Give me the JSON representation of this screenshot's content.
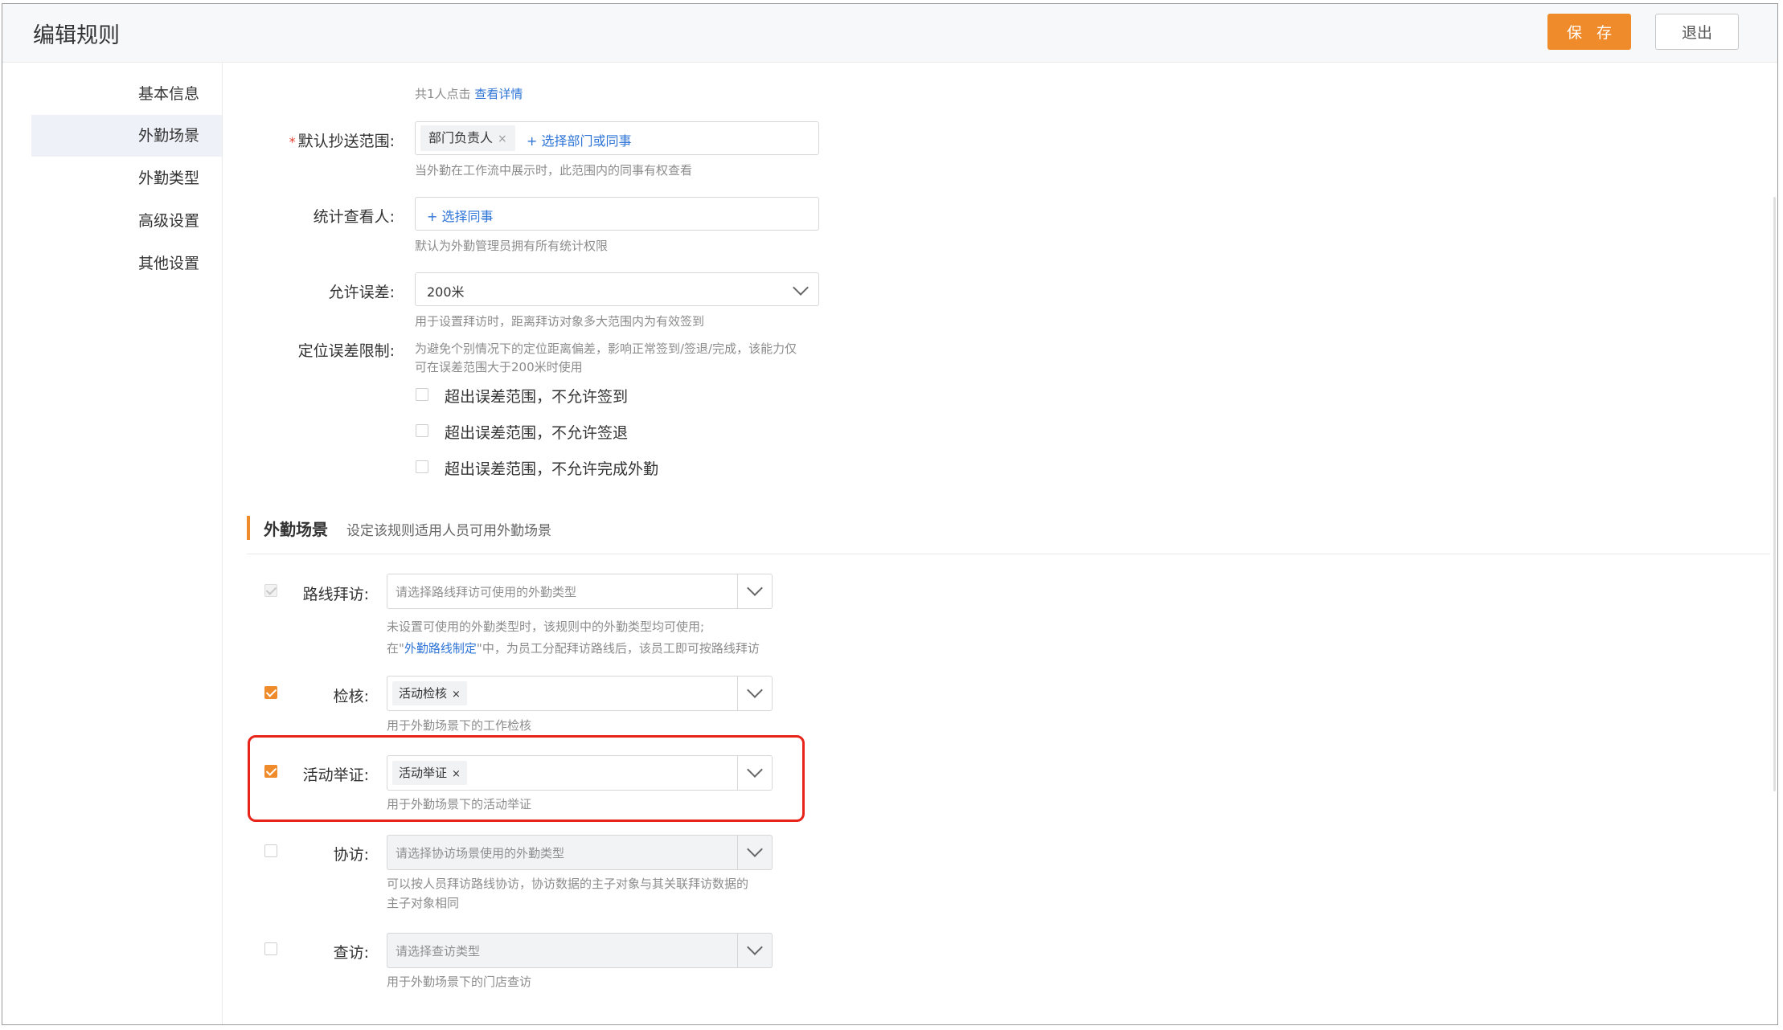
{
  "header": {
    "title": "编辑规则",
    "save_label": "保 存",
    "exit_label": "退出"
  },
  "sidebar": {
    "items": [
      {
        "label": "基本信息"
      },
      {
        "label": "外勤场景"
      },
      {
        "label": "外勤类型"
      },
      {
        "label": "高级设置"
      },
      {
        "label": "其他设置"
      }
    ],
    "active": "外勤场景"
  },
  "clicks": {
    "text": "共1人点击",
    "link": "查看详情"
  },
  "cc_scope": {
    "required_mark": "*",
    "label": "默认抄送范围:",
    "tag": "部门负责人",
    "tag_close": "×",
    "add_link": "+ 选择部门或同事",
    "hint": "当外勤在工作流中展示时，此范围内的同事有权查看"
  },
  "stats_viewer": {
    "label": "统计查看人:",
    "add_link": "+ 选择同事",
    "hint": "默认为外勤管理员拥有所有统计权限"
  },
  "tolerance": {
    "label": "允许误差:",
    "value": "200米",
    "hint": "用于设置拜访时，距离拜访对象多大范围内为有效签到"
  },
  "location_limit": {
    "label": "定位误差限制:",
    "hint_line1": "为避免个别情况下的定位距离偏差，影响正常签到/签退/完成，该能力仅",
    "hint_line2": "可在误差范围大于200米时使用",
    "options": [
      {
        "label": "超出误差范围，不允许签到",
        "checked": false
      },
      {
        "label": "超出误差范围，不允许签退",
        "checked": false
      },
      {
        "label": "超出误差范围，不允许完成外勤",
        "checked": false
      }
    ]
  },
  "scene_section": {
    "title": "外勤场景",
    "desc": "设定该规则适用人员可用外勤场景"
  },
  "scenes": {
    "route_visit": {
      "label": "路线拜访:",
      "checked": true,
      "disabled": true,
      "placeholder": "请选择路线拜访可使用的外勤类型",
      "hint_line1": "未设置可使用的外勤类型时，该规则中的外勤类型均可使用;",
      "hint_line2_pre": "在\"",
      "hint_line2_link": "外勤路线制定",
      "hint_line2_post": "\"中，为员工分配拜访路线后，该员工即可按路线拜访"
    },
    "inspection": {
      "label": "检核:",
      "checked": true,
      "tag": "活动检核",
      "tag_close": "×",
      "hint": "用于外勤场景下的工作检核"
    },
    "evidence": {
      "label": "活动举证:",
      "checked": true,
      "tag": "活动举证",
      "tag_close": "×",
      "hint": "用于外勤场景下的活动举证"
    },
    "co_visit": {
      "label": "协访:",
      "checked": false,
      "placeholder": "请选择协访场景使用的外勤类型",
      "hint_line1": "可以按人员拜访路线协访，协访数据的主子对象与其关联拜访数据的",
      "hint_line2": "主子对象相同"
    },
    "check_visit": {
      "label": "查访:",
      "checked": false,
      "placeholder": "请选择查访类型",
      "hint": "用于外勤场景下的门店查访"
    }
  },
  "colors": {
    "accent": "#f08b2c",
    "link": "#2d74d6",
    "highlight": "#e8231a"
  }
}
